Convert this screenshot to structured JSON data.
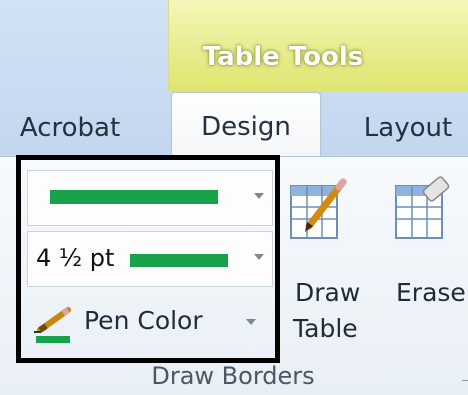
{
  "ribbon": {
    "contextual_group": "Table Tools",
    "tabs": [
      {
        "label": "Acrobat"
      },
      {
        "label": "Design",
        "active": true
      },
      {
        "label": "Layout"
      }
    ]
  },
  "draw_borders": {
    "group_label": "Draw Borders",
    "pen_style": {
      "sample": "solid-line"
    },
    "pen_weight": {
      "label": "4 ½ pt"
    },
    "pen_color": {
      "label": "Pen Color",
      "color": "#18a34a"
    },
    "draw_table": {
      "line1": "Draw",
      "line2": "Table"
    },
    "eraser": {
      "label": "Eraser"
    }
  },
  "colors": {
    "accent_line": "#18a34a",
    "contextual_band": "#dfe46d"
  }
}
